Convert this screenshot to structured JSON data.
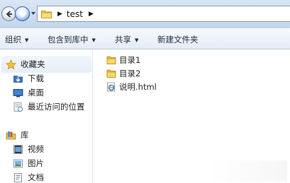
{
  "address_bar": {
    "breadcrumb": [
      "test"
    ]
  },
  "toolbar": {
    "organize_label": "组织",
    "include_library_label": "包含到库中",
    "share_label": "共享",
    "new_folder_label": "新建文件夹"
  },
  "nav_pane": {
    "favorites": {
      "header": "收藏夹",
      "items": [
        {
          "label": "下载",
          "icon": "download-folder-icon"
        },
        {
          "label": "桌面",
          "icon": "desktop-icon"
        },
        {
          "label": "最近访问的位置",
          "icon": "recent-places-icon"
        }
      ]
    },
    "libraries": {
      "header": "库",
      "items": [
        {
          "label": "视频",
          "icon": "videos-icon"
        },
        {
          "label": "图片",
          "icon": "pictures-icon"
        },
        {
          "label": "文档",
          "icon": "documents-icon"
        }
      ]
    }
  },
  "files": [
    {
      "name": "目录1",
      "type": "folder"
    },
    {
      "name": "目录2",
      "type": "folder"
    },
    {
      "name": "说明.html",
      "type": "html"
    }
  ]
}
